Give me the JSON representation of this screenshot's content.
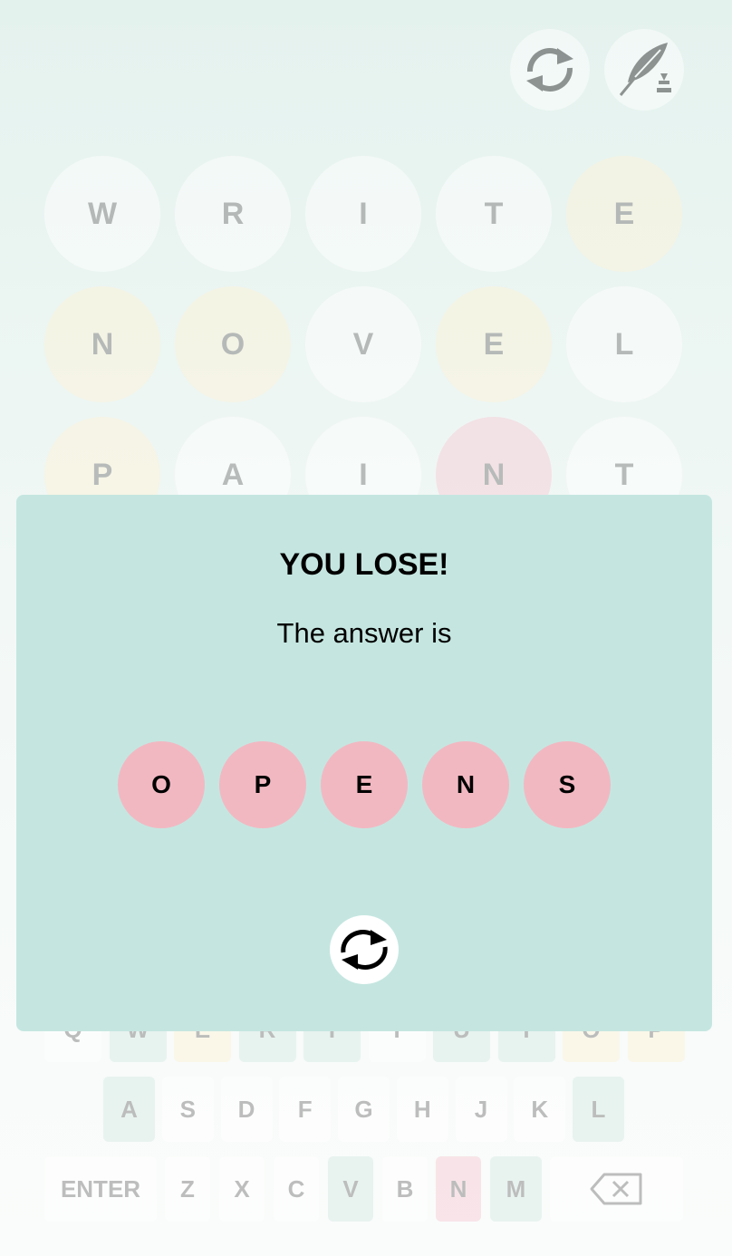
{
  "header": {
    "reload_icon": "reload-icon",
    "quill_icon": "quill-ink-icon"
  },
  "board": {
    "rows": [
      [
        {
          "letter": "W",
          "state": "absent"
        },
        {
          "letter": "R",
          "state": "absent"
        },
        {
          "letter": "I",
          "state": "absent"
        },
        {
          "letter": "T",
          "state": "absent"
        },
        {
          "letter": "E",
          "state": "present"
        }
      ],
      [
        {
          "letter": "N",
          "state": "present"
        },
        {
          "letter": "O",
          "state": "present"
        },
        {
          "letter": "V",
          "state": "absent"
        },
        {
          "letter": "E",
          "state": "present"
        },
        {
          "letter": "L",
          "state": "absent"
        }
      ],
      [
        {
          "letter": "P",
          "state": "present"
        },
        {
          "letter": "A",
          "state": "absent"
        },
        {
          "letter": "I",
          "state": "absent"
        },
        {
          "letter": "N",
          "state": "wrong"
        },
        {
          "letter": "T",
          "state": "absent"
        }
      ]
    ]
  },
  "keyboard": {
    "row1": [
      {
        "label": "Q",
        "state": "none"
      },
      {
        "label": "W",
        "state": "gray"
      },
      {
        "label": "E",
        "state": "yellow"
      },
      {
        "label": "R",
        "state": "gray"
      },
      {
        "label": "T",
        "state": "gray"
      },
      {
        "label": "Y",
        "state": "none"
      },
      {
        "label": "U",
        "state": "gray"
      },
      {
        "label": "I",
        "state": "gray"
      },
      {
        "label": "O",
        "state": "yellow"
      },
      {
        "label": "P",
        "state": "yellow"
      }
    ],
    "row2": [
      {
        "label": "A",
        "state": "gray"
      },
      {
        "label": "S",
        "state": "none"
      },
      {
        "label": "D",
        "state": "none"
      },
      {
        "label": "F",
        "state": "none"
      },
      {
        "label": "G",
        "state": "none"
      },
      {
        "label": "H",
        "state": "none"
      },
      {
        "label": "J",
        "state": "none"
      },
      {
        "label": "K",
        "state": "none"
      },
      {
        "label": "L",
        "state": "gray"
      }
    ],
    "row3": [
      {
        "label": "ENTER",
        "state": "none"
      },
      {
        "label": "Z",
        "state": "none"
      },
      {
        "label": "X",
        "state": "none"
      },
      {
        "label": "C",
        "state": "none"
      },
      {
        "label": "V",
        "state": "gray"
      },
      {
        "label": "B",
        "state": "none"
      },
      {
        "label": "N",
        "state": "pink"
      },
      {
        "label": "M",
        "state": "gray"
      },
      {
        "label": "",
        "state": "none",
        "icon": "backspace-icon"
      }
    ]
  },
  "modal": {
    "title": "YOU LOSE!",
    "subtitle": "The answer is",
    "answer": [
      "O",
      "P",
      "E",
      "N",
      "S"
    ],
    "reload_icon": "reload-icon"
  },
  "colors": {
    "present": "#fdf2d8",
    "wrong": "#f7cdd6",
    "absent_key": "#d6ebe5",
    "modal_bg": "#c5e6e0",
    "answer_tile": "#f2b8c2",
    "tile_text": "#7f7f7f"
  }
}
